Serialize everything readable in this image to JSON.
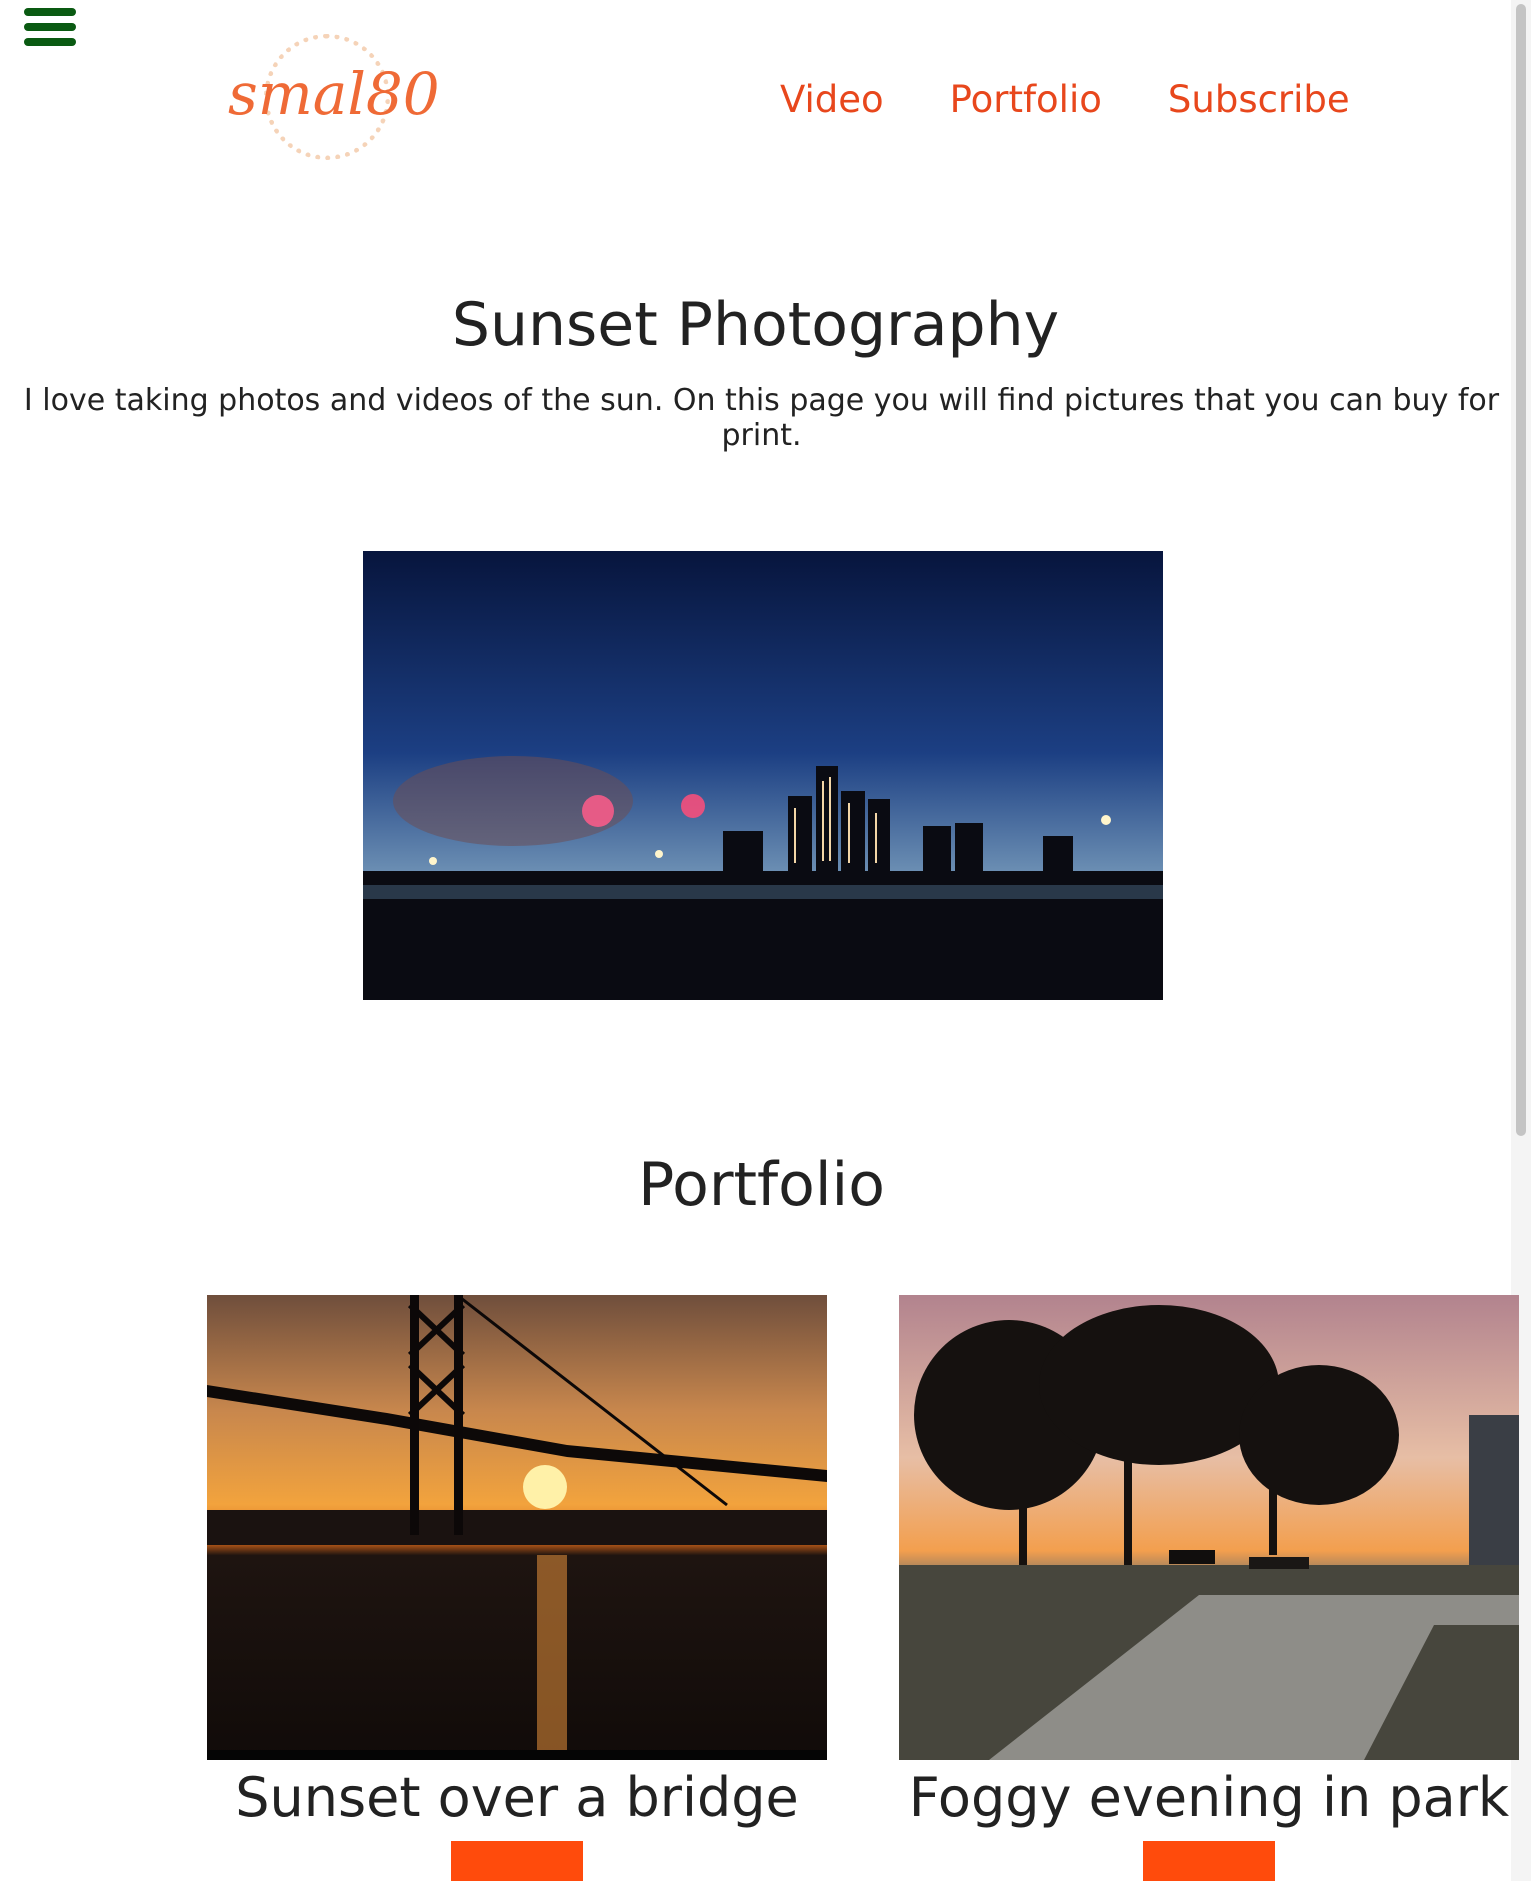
{
  "header": {
    "menu_icon": "hamburger-menu-icon",
    "logo_text": "smal80",
    "nav": [
      "Video",
      "Portfolio",
      "Subscribe"
    ],
    "colors": {
      "accent": "#e8471c",
      "menu_icon": "#0a5a12",
      "button": "#ff4b0c"
    }
  },
  "main": {
    "title": "Sunset Photography",
    "intro": "I love taking photos and videos of the sun. On this page you will find pictures that you can buy for print."
  },
  "portfolio": {
    "title": "Portfolio",
    "items": [
      {
        "caption": "Sunset over a bridge"
      },
      {
        "caption": "Foggy evening in park"
      }
    ]
  }
}
